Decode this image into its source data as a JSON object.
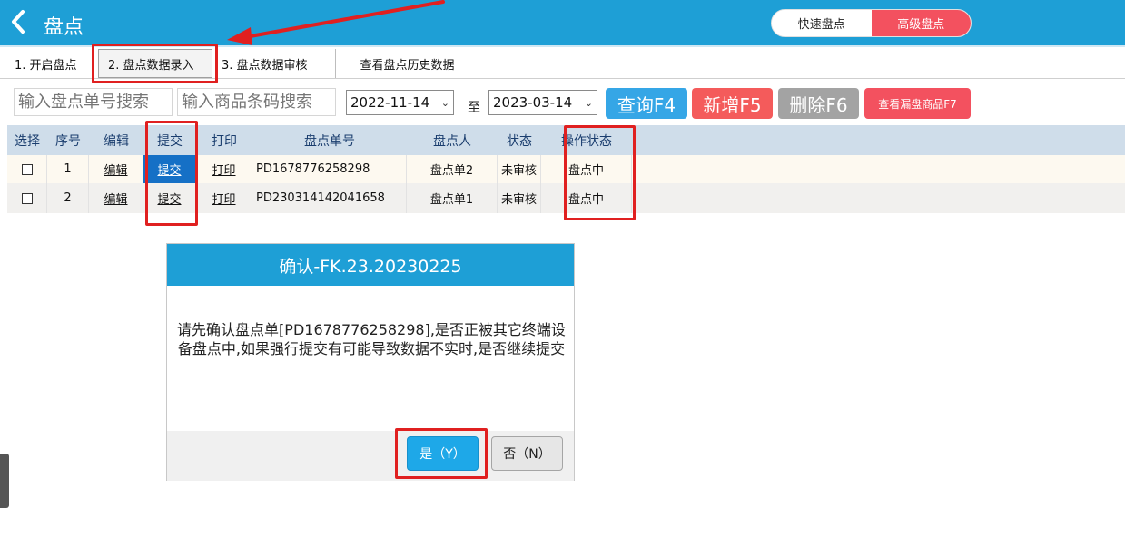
{
  "header": {
    "title": "盘点",
    "modes": {
      "quick": "快速盘点",
      "advanced": "高级盘点"
    }
  },
  "tabs": [
    {
      "label": "1. 开启盘点"
    },
    {
      "label": "2. 盘点数据录入"
    },
    {
      "label": "3. 盘点数据审核"
    },
    {
      "label": "查看盘点历史数据"
    }
  ],
  "search": {
    "order_placeholder": "输入盘点单号搜索",
    "barcode_placeholder": "输入商品条码搜索",
    "date_from": "2022-11-14",
    "to_label": "至",
    "date_to": "2023-03-14"
  },
  "actions": {
    "query": "查询F4",
    "add": "新增F5",
    "delete": "删除F6",
    "missing": "查看漏盘商品F7"
  },
  "table": {
    "headers": [
      "选择",
      "序号",
      "编辑",
      "提交",
      "打印",
      "盘点单号",
      "盘点人",
      "状态",
      "操作状态"
    ],
    "rows": [
      {
        "index": "1",
        "edit": "编辑",
        "submit": "提交",
        "print": "打印",
        "order_no": "PD1678776258298",
        "counter": "盘点单2",
        "status": "未审核",
        "op_status": "盘点中"
      },
      {
        "index": "2",
        "edit": "编辑",
        "submit": "提交",
        "print": "打印",
        "order_no": "PD230314142041658",
        "counter": "盘点单1",
        "status": "未审核",
        "op_status": "盘点中"
      }
    ]
  },
  "dialog": {
    "title": "确认-FK.23.20230225",
    "message": "请先确认盘点单[PD1678776258298],是否正被其它终端设备盘点中,如果强行提交有可能导致数据不实时,是否继续提交",
    "yes": "是（Y）",
    "no": "否（N）"
  },
  "colors": {
    "header": "#1e9fd6",
    "query": "#35a6e6",
    "add": "#f45b5b",
    "delete": "#a3a3a3",
    "missing": "#f3515f",
    "highlight": "#e02020"
  }
}
